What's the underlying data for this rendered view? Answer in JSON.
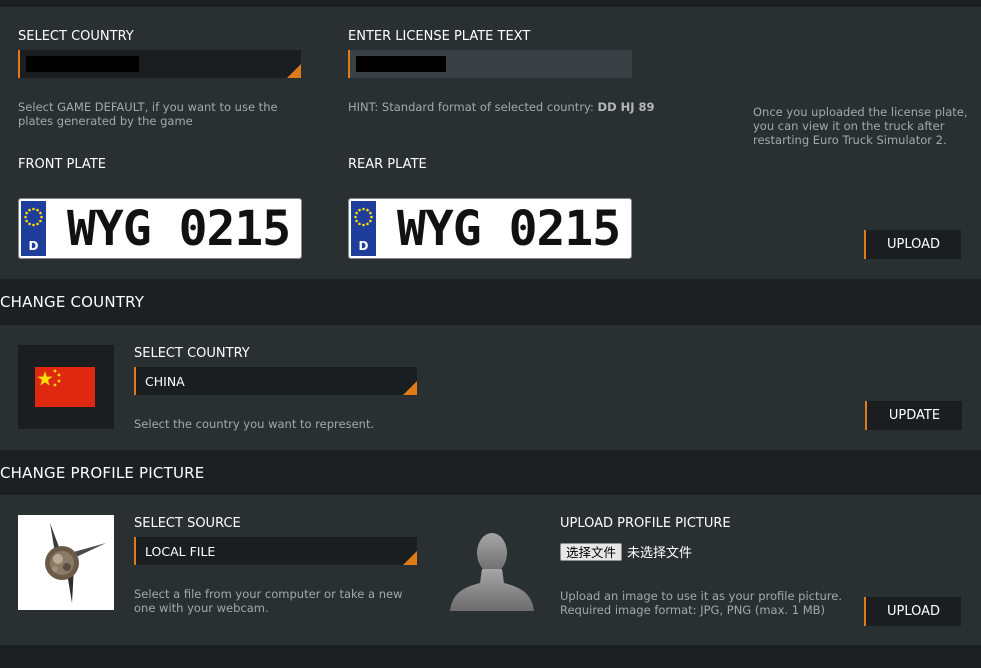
{
  "plate_section": {
    "select_country_label": "SELECT COUNTRY",
    "enter_text_label": "ENTER LICENSE PLATE TEXT",
    "country_hint": "Select GAME DEFAULT, if you want to use the plates generated by the game",
    "format_hint_prefix": "HINT: Standard format of selected country: ",
    "format_hint_value": "DD HJ 89",
    "upload_info": "Once you uploaded the license plate, you can view it on the truck after restarting Euro Truck Simulator 2.",
    "front_plate_label": "FRONT PLATE",
    "rear_plate_label": "REAR PLATE",
    "front_plate": {
      "country_code": "D",
      "text": "WYG 0215"
    },
    "rear_plate": {
      "country_code": "D",
      "text": "WYG 0215"
    },
    "upload_label": "UPLOAD"
  },
  "country_section": {
    "title": "CHANGE COUNTRY",
    "select_label": "SELECT COUNTRY",
    "selected_value": "CHINA",
    "hint": "Select the country you want to represent.",
    "update_label": "UPDATE",
    "flag_icon": "china-flag-icon"
  },
  "profile_section": {
    "title": "CHANGE PROFILE PICTURE",
    "select_source_label": "SELECT SOURCE",
    "source_value": "LOCAL FILE",
    "source_hint": "Select a file from your computer or take a new one with your webcam.",
    "upload_picture_label": "UPLOAD PROFILE PICTURE",
    "choose_file_button": "选择文件",
    "no_file_text": "未选择文件",
    "upload_hint_line1": "Upload an image to use it as your profile picture.",
    "upload_hint_line2": "Required image format: JPG, PNG (max. 1 MB)",
    "upload_label": "UPLOAD",
    "avatar_icon": "user-silhouette-icon",
    "current_picture_icon": "propeller-picture-icon"
  },
  "colors": {
    "accent": "#e07b1a",
    "panel": "#2a2f32",
    "background": "#1c2023",
    "plate_band": "#1f3e9c",
    "china_red": "#de2910",
    "china_yellow": "#ffde00"
  }
}
